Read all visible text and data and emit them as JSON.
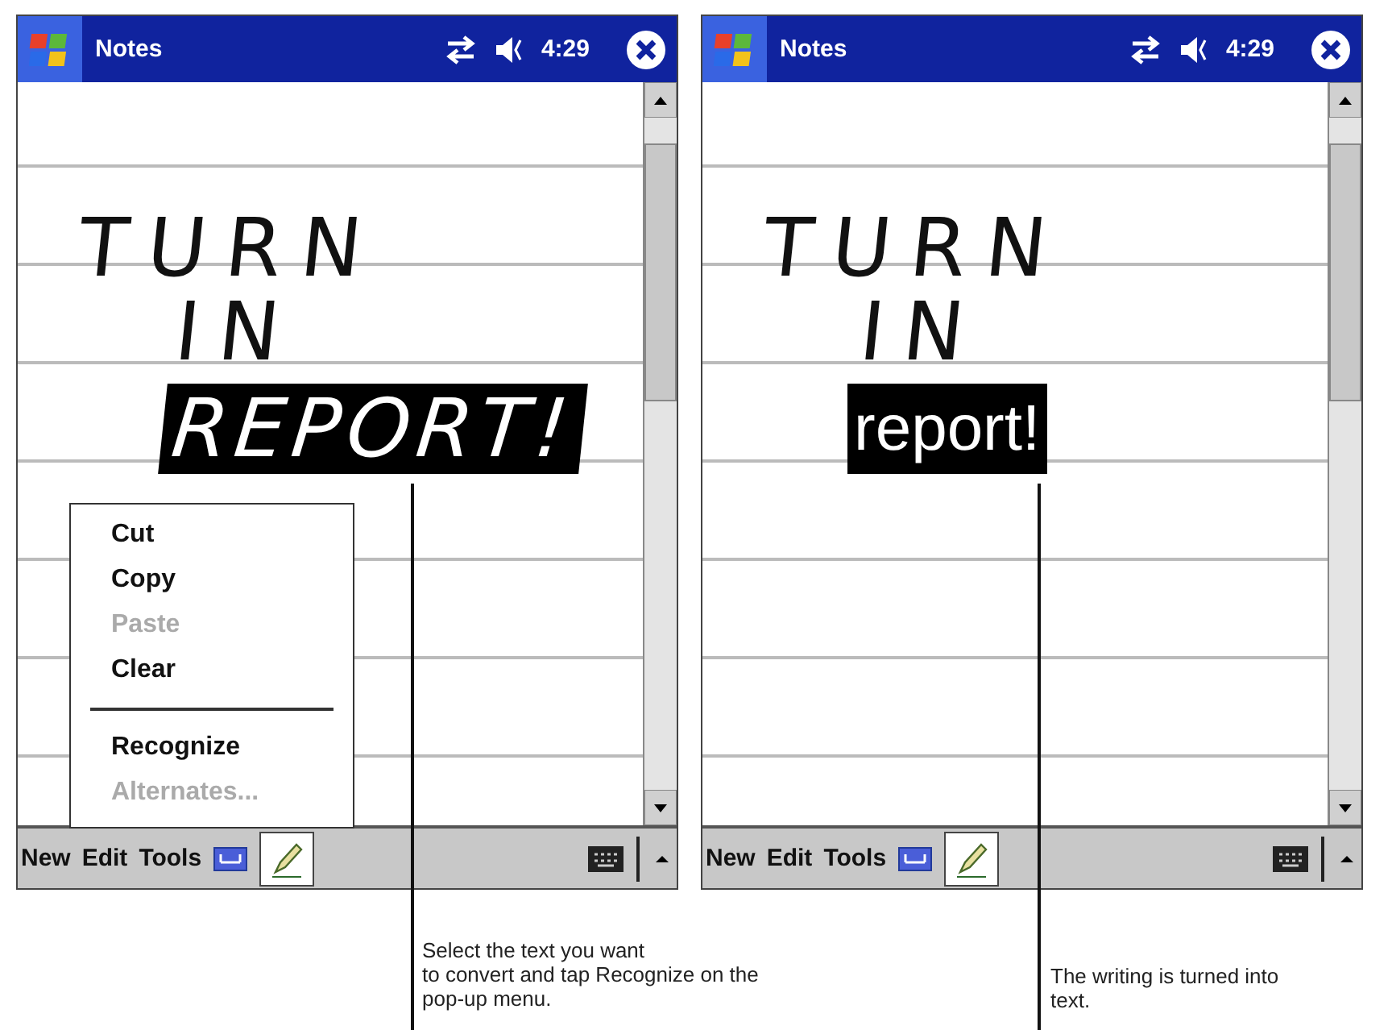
{
  "screens": [
    {
      "title_bar": {
        "title": "Notes",
        "time": "4:29"
      },
      "note_lines": [
        {
          "kind": "ink",
          "text": "TURN",
          "selected": false
        },
        {
          "kind": "ink",
          "text": "IN",
          "selected": false
        },
        {
          "kind": "ink",
          "text": "REPORT!",
          "selected": true
        }
      ],
      "popup_menu": [
        {
          "kind": "item",
          "label": "Cut",
          "disabled": false
        },
        {
          "kind": "item",
          "label": "Copy",
          "disabled": false
        },
        {
          "kind": "item",
          "label": "Paste",
          "disabled": true
        },
        {
          "kind": "item",
          "label": "Clear",
          "disabled": false
        },
        {
          "kind": "separator"
        },
        {
          "kind": "item",
          "label": "Recognize",
          "disabled": false
        },
        {
          "kind": "item",
          "label": "Alternates...",
          "disabled": true
        }
      ],
      "menu_bar": {
        "items": [
          "New",
          "Edit",
          "Tools"
        ],
        "pen_selected": true
      },
      "caption": "Select the text you want\nto convert and tap Recognize on the\npop-up menu."
    },
    {
      "title_bar": {
        "title": "Notes",
        "time": "4:29"
      },
      "note_lines": [
        {
          "kind": "ink",
          "text": "TURN",
          "selected": false
        },
        {
          "kind": "ink",
          "text": "IN",
          "selected": false
        },
        {
          "kind": "typed",
          "text": "report!",
          "selected": true
        }
      ],
      "menu_bar": {
        "items": [
          "New",
          "Edit",
          "Tools"
        ],
        "pen_selected": true
      },
      "caption": "The writing is turned into\ntext."
    }
  ]
}
